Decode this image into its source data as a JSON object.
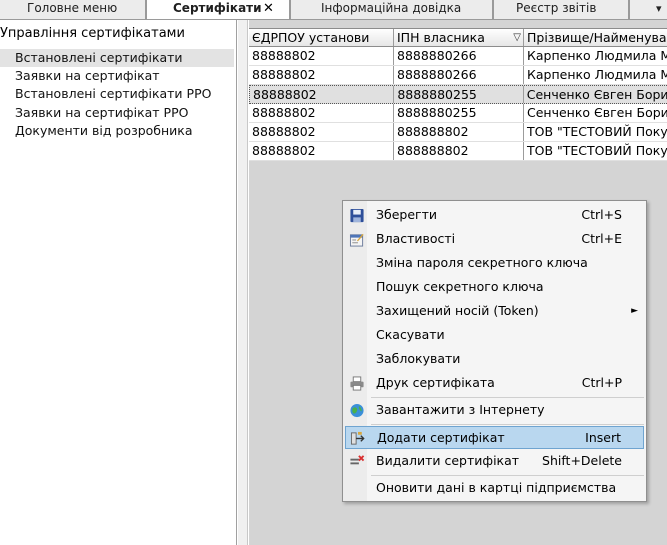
{
  "tabs": [
    {
      "label": "Головне меню"
    },
    {
      "label": "Сертифікати",
      "close": "✕"
    },
    {
      "label": "Інформаційна довідка"
    },
    {
      "label": "Реєстр звітів"
    }
  ],
  "sidebar": {
    "title": "Управління сертифікатами",
    "items": [
      {
        "label": "Встановлені сертифікати"
      },
      {
        "label": "Заявки на сертифікат"
      },
      {
        "label": "Встановлені сертифікати РРО"
      },
      {
        "label": "Заявки на сертифікат РРО"
      },
      {
        "label": "Документи від розробника"
      }
    ],
    "selected_index": 0
  },
  "table": {
    "columns": [
      "ЄДРПОУ установи",
      "ІПН власника",
      "Прізвище/Найменування"
    ],
    "rows": [
      [
        "88888802",
        "8888880266",
        "Карпенко Людмила М"
      ],
      [
        "88888802",
        "8888880266",
        "Карпенко Людмила М"
      ],
      [
        "88888802",
        "8888880255",
        "Сенченко Євген Бори"
      ],
      [
        "88888802",
        "8888880255",
        "Сенченко Євген Бори"
      ],
      [
        "88888802",
        "888888802",
        "ТОВ \"ТЕСТОВИЙ Покуп"
      ],
      [
        "88888802",
        "888888802",
        "ТОВ \"ТЕСТОВИЙ Покуп"
      ]
    ],
    "selected_row": 2
  },
  "context_menu": {
    "items": [
      {
        "label": "Зберегти",
        "shortcut": "Ctrl+S",
        "icon": "save-icon"
      },
      {
        "label": "Властивості",
        "shortcut": "Ctrl+E",
        "icon": "properties-icon"
      },
      {
        "label": "Зміна пароля секретного ключа",
        "shortcut": "",
        "icon": ""
      },
      {
        "label": "Пошук секретного ключа",
        "shortcut": "",
        "icon": ""
      },
      {
        "label": "Захищений носій (Token)",
        "shortcut": "",
        "icon": "",
        "submenu_arrow": "►"
      },
      {
        "label": "Скасувати",
        "shortcut": "",
        "icon": ""
      },
      {
        "label": "Заблокувати",
        "shortcut": "",
        "icon": ""
      },
      {
        "label": "Друк сертифіката",
        "shortcut": "Ctrl+P",
        "icon": "printer-icon"
      },
      {
        "label": "Завантажити з Інтернету",
        "shortcut": "",
        "icon": "globe-icon"
      },
      {
        "label": "Додати сертифікат",
        "shortcut": "Insert",
        "icon": "add-certificate-icon"
      },
      {
        "label": "Видалити сертифікат",
        "shortcut": "Shift+Delete",
        "icon": "delete-certificate-icon"
      },
      {
        "label": "Оновити дані в картці підприємства",
        "shortcut": "",
        "icon": ""
      }
    ],
    "highlighted_index": 9
  },
  "colors": {
    "menu_highlight": "#b9d7ef",
    "tab_active_bg": "#ffffff",
    "grid_background": "#d4d4d4"
  }
}
